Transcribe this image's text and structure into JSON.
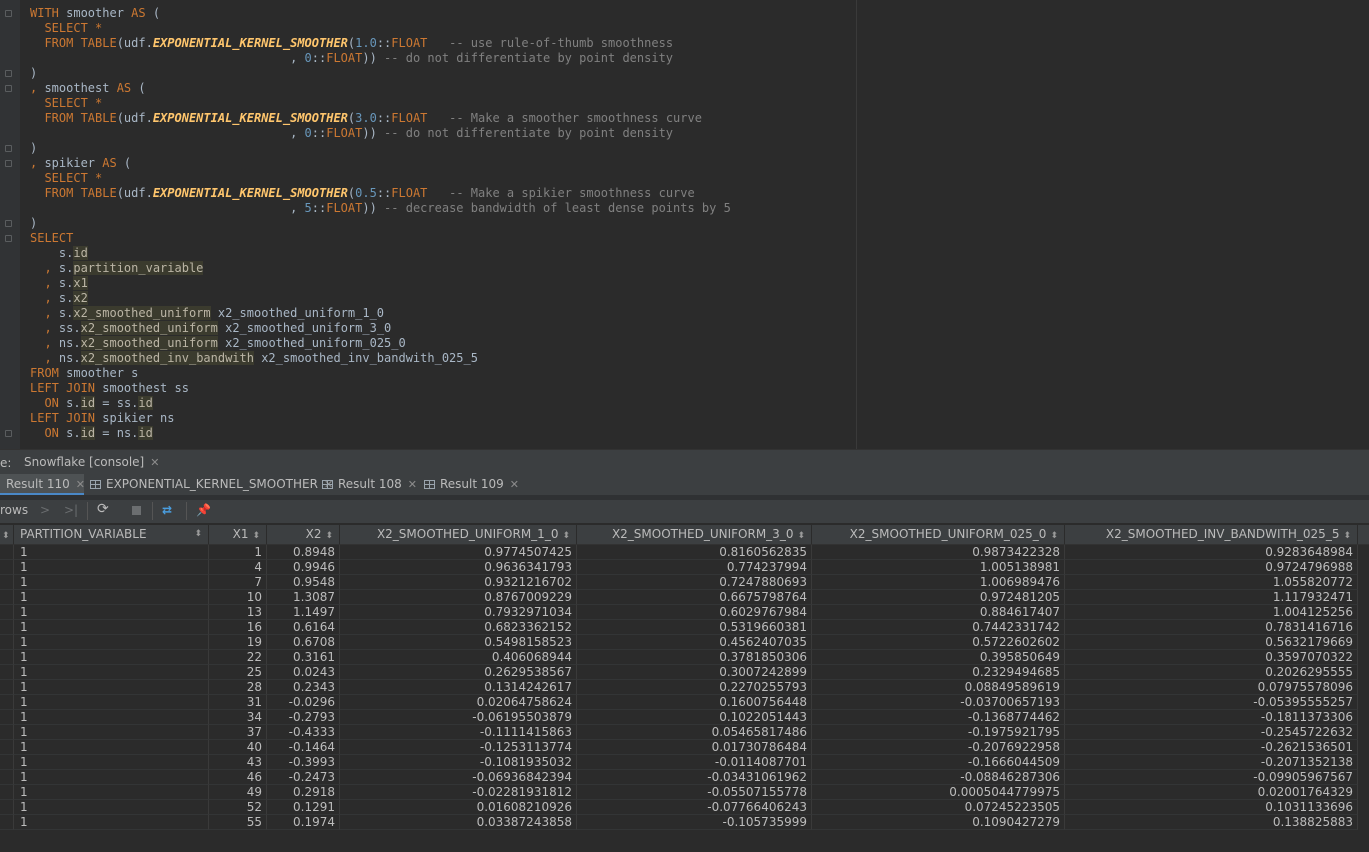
{
  "editor": {
    "lines": [
      [
        [
          "kw",
          "WITH "
        ],
        [
          "pl",
          "smoother "
        ],
        [
          "kw",
          "AS"
        ],
        [
          "pl",
          " ("
        ]
      ],
      [
        [
          "pl",
          "  "
        ],
        [
          "kw",
          "SELECT "
        ],
        [
          "kw",
          "*"
        ]
      ],
      [
        [
          "pl",
          "  "
        ],
        [
          "kw",
          "FROM "
        ],
        [
          "kw",
          "TABLE"
        ],
        [
          "pl",
          "(udf."
        ],
        [
          "fn",
          "EXPONENTIAL_KERNEL_SMOOTHER"
        ],
        [
          "pl",
          "("
        ],
        [
          "num",
          "1.0"
        ],
        [
          "pl",
          "::"
        ],
        [
          "kw",
          "FLOAT"
        ],
        [
          "pl",
          "   "
        ],
        [
          "cm",
          "-- use rule-of-thumb smoothness"
        ]
      ],
      [
        [
          "pl",
          "                                    , "
        ],
        [
          "num",
          "0"
        ],
        [
          "pl",
          "::"
        ],
        [
          "kw",
          "FLOAT"
        ],
        [
          "pl",
          ")) "
        ],
        [
          "cm",
          "-- do not differentiate by point density"
        ]
      ],
      [
        [
          "pl",
          ")"
        ]
      ],
      [
        [
          "kw",
          ", "
        ],
        [
          "pl",
          "smoothest "
        ],
        [
          "kw",
          "AS"
        ],
        [
          "pl",
          " ("
        ]
      ],
      [
        [
          "pl",
          "  "
        ],
        [
          "kw",
          "SELECT "
        ],
        [
          "kw",
          "*"
        ]
      ],
      [
        [
          "pl",
          "  "
        ],
        [
          "kw",
          "FROM "
        ],
        [
          "kw",
          "TABLE"
        ],
        [
          "pl",
          "(udf."
        ],
        [
          "fn",
          "EXPONENTIAL_KERNEL_SMOOTHER"
        ],
        [
          "pl",
          "("
        ],
        [
          "num",
          "3.0"
        ],
        [
          "pl",
          "::"
        ],
        [
          "kw",
          "FLOAT"
        ],
        [
          "pl",
          "   "
        ],
        [
          "cm",
          "-- Make a smoother smoothness curve"
        ]
      ],
      [
        [
          "pl",
          "                                    , "
        ],
        [
          "num",
          "0"
        ],
        [
          "pl",
          "::"
        ],
        [
          "kw",
          "FLOAT"
        ],
        [
          "pl",
          ")) "
        ],
        [
          "cm",
          "-- do not differentiate by point density"
        ]
      ],
      [
        [
          "pl",
          ")"
        ]
      ],
      [
        [
          "kw",
          ", "
        ],
        [
          "pl",
          "spikier "
        ],
        [
          "kw",
          "AS"
        ],
        [
          "pl",
          " ("
        ]
      ],
      [
        [
          "pl",
          "  "
        ],
        [
          "kw",
          "SELECT "
        ],
        [
          "kw",
          "*"
        ]
      ],
      [
        [
          "pl",
          "  "
        ],
        [
          "kw",
          "FROM "
        ],
        [
          "kw",
          "TABLE"
        ],
        [
          "pl",
          "(udf."
        ],
        [
          "fn",
          "EXPONENTIAL_KERNEL_SMOOTHER"
        ],
        [
          "pl",
          "("
        ],
        [
          "num",
          "0.5"
        ],
        [
          "pl",
          "::"
        ],
        [
          "kw",
          "FLOAT"
        ],
        [
          "pl",
          "   "
        ],
        [
          "cm",
          "-- Make a spikier smoothness curve"
        ]
      ],
      [
        [
          "pl",
          "                                    , "
        ],
        [
          "num",
          "5"
        ],
        [
          "pl",
          "::"
        ],
        [
          "kw",
          "FLOAT"
        ],
        [
          "pl",
          ")) "
        ],
        [
          "cm",
          "-- decrease bandwidth of least dense points by 5"
        ]
      ],
      [
        [
          "pl",
          ")"
        ]
      ],
      [
        [
          "kw",
          "SELECT"
        ]
      ],
      [
        [
          "pl",
          "    s."
        ],
        [
          "hl",
          "id"
        ]
      ],
      [
        [
          "pl",
          "  "
        ],
        [
          "kw",
          ", "
        ],
        [
          "pl",
          "s."
        ],
        [
          "hl",
          "partition_variable"
        ]
      ],
      [
        [
          "pl",
          "  "
        ],
        [
          "kw",
          ", "
        ],
        [
          "pl",
          "s."
        ],
        [
          "hl",
          "x1"
        ]
      ],
      [
        [
          "pl",
          "  "
        ],
        [
          "kw",
          ", "
        ],
        [
          "pl",
          "s."
        ],
        [
          "hl",
          "x2"
        ]
      ],
      [
        [
          "pl",
          "  "
        ],
        [
          "kw",
          ", "
        ],
        [
          "pl",
          "s."
        ],
        [
          "hl",
          "x2_smoothed_uniform"
        ],
        [
          "pl",
          " x2_smoothed_uniform_1_0"
        ]
      ],
      [
        [
          "pl",
          "  "
        ],
        [
          "kw",
          ", "
        ],
        [
          "pl",
          "ss."
        ],
        [
          "hl",
          "x2_smoothed_uniform"
        ],
        [
          "pl",
          " x2_smoothed_uniform_3_0"
        ]
      ],
      [
        [
          "pl",
          "  "
        ],
        [
          "kw",
          ", "
        ],
        [
          "pl",
          "ns."
        ],
        [
          "hl",
          "x2_smoothed_uniform"
        ],
        [
          "pl",
          " x2_smoothed_uniform_025_0"
        ]
      ],
      [
        [
          "pl",
          "  "
        ],
        [
          "kw",
          ", "
        ],
        [
          "pl",
          "ns."
        ],
        [
          "hl",
          "x2_smoothed_inv_bandwith"
        ],
        [
          "pl",
          " x2_smoothed_inv_bandwith_025_5"
        ]
      ],
      [
        [
          "kw",
          "FROM "
        ],
        [
          "pl",
          "smoother s"
        ]
      ],
      [
        [
          "kw",
          "LEFT JOIN "
        ],
        [
          "pl",
          "smoothest ss"
        ]
      ],
      [
        [
          "pl",
          "  "
        ],
        [
          "kw",
          "ON "
        ],
        [
          "pl",
          "s."
        ],
        [
          "hl",
          "id"
        ],
        [
          "pl",
          " = ss."
        ],
        [
          "hl",
          "id"
        ]
      ],
      [
        [
          "kw",
          "LEFT JOIN "
        ],
        [
          "pl",
          "spikier ns"
        ]
      ],
      [
        [
          "pl",
          "  "
        ],
        [
          "kw",
          "ON "
        ],
        [
          "pl",
          "s."
        ],
        [
          "hl",
          "id"
        ],
        [
          "pl",
          " = ns."
        ],
        [
          "hl",
          "id"
        ]
      ]
    ]
  },
  "services": {
    "prefix": "e:",
    "console_tab": "Snowflake [console]"
  },
  "result_tabs": [
    "Result 110",
    "EXPONENTIAL_KERNEL_SMOOTHER",
    "Result 108",
    "Result 109"
  ],
  "toolbar": {
    "rows_label": "rows"
  },
  "grid": {
    "columns": [
      "PARTITION_VARIABLE",
      "X1",
      "X2",
      "X2_SMOOTHED_UNIFORM_1_0",
      "X2_SMOOTHED_UNIFORM_3_0",
      "X2_SMOOTHED_UNIFORM_025_0",
      "X2_SMOOTHED_INV_BANDWITH_025_5"
    ],
    "rows": [
      [
        "1",
        "1",
        "0.8948",
        "0.9774507425",
        "0.8160562835",
        "0.9873422328",
        "0.9283648984"
      ],
      [
        "1",
        "4",
        "0.9946",
        "0.9636341793",
        "0.774237994",
        "1.005138981",
        "0.9724796988"
      ],
      [
        "1",
        "7",
        "0.9548",
        "0.9321216702",
        "0.7247880693",
        "1.006989476",
        "1.055820772"
      ],
      [
        "1",
        "10",
        "1.3087",
        "0.8767009229",
        "0.6675798764",
        "0.972481205",
        "1.117932471"
      ],
      [
        "1",
        "13",
        "1.1497",
        "0.7932971034",
        "0.6029767984",
        "0.884617407",
        "1.004125256"
      ],
      [
        "1",
        "16",
        "0.6164",
        "0.6823362152",
        "0.5319660381",
        "0.7442331742",
        "0.7831416716"
      ],
      [
        "1",
        "19",
        "0.6708",
        "0.5498158523",
        "0.4562407035",
        "0.5722602602",
        "0.5632179669"
      ],
      [
        "1",
        "22",
        "0.3161",
        "0.406068944",
        "0.3781850306",
        "0.395850649",
        "0.3597070322"
      ],
      [
        "1",
        "25",
        "0.0243",
        "0.2629538567",
        "0.3007242899",
        "0.2329494685",
        "0.2026295555"
      ],
      [
        "1",
        "28",
        "0.2343",
        "0.1314242617",
        "0.2270255793",
        "0.08849589619",
        "0.07975578096"
      ],
      [
        "1",
        "31",
        "-0.0296",
        "0.02064758624",
        "0.1600756448",
        "-0.03700657193",
        "-0.05395555257"
      ],
      [
        "1",
        "34",
        "-0.2793",
        "-0.06195503879",
        "0.1022051443",
        "-0.1368774462",
        "-0.1811373306"
      ],
      [
        "1",
        "37",
        "-0.4333",
        "-0.1111415863",
        "0.05465817486",
        "-0.1975921795",
        "-0.2545722632"
      ],
      [
        "1",
        "40",
        "-0.1464",
        "-0.1253113774",
        "0.01730786484",
        "-0.2076922958",
        "-0.2621536501"
      ],
      [
        "1",
        "43",
        "-0.3993",
        "-0.1081935032",
        "-0.0114087701",
        "-0.1666044509",
        "-0.2071352138"
      ],
      [
        "1",
        "46",
        "-0.2473",
        "-0.06936842394",
        "-0.03431061962",
        "-0.08846287306",
        "-0.09905967567"
      ],
      [
        "1",
        "49",
        "0.2918",
        "-0.02281931812",
        "-0.05507155778",
        "0.0005044779975",
        "0.02001764329"
      ],
      [
        "1",
        "52",
        "0.1291",
        "0.01608210926",
        "-0.07766406243",
        "0.07245223505",
        "0.1031133696"
      ],
      [
        "1",
        "55",
        "0.1974",
        "0.03387243858",
        "-0.105735999",
        "0.1090427279",
        "0.138825883"
      ]
    ]
  }
}
